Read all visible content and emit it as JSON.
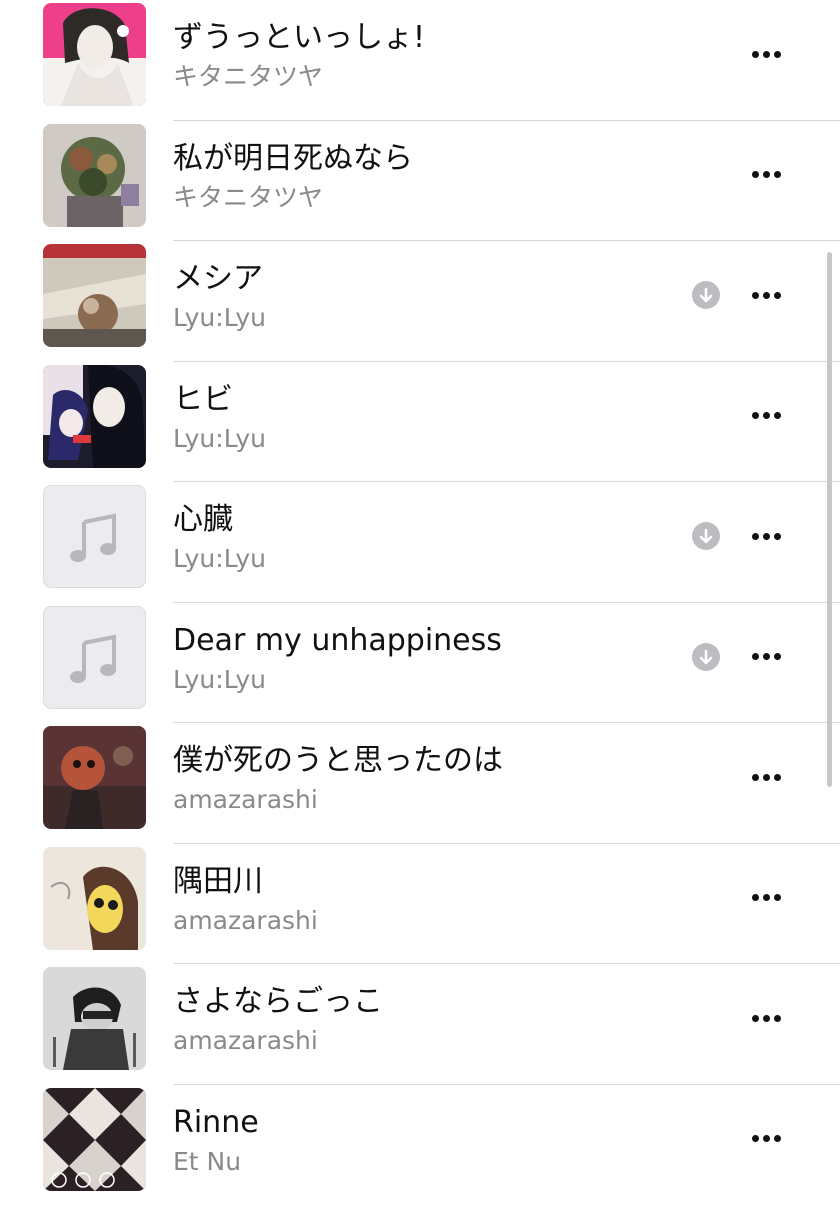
{
  "songs": [
    {
      "title": "ずうっといっしょ!",
      "artist": "キタニタツヤ",
      "downloaded": false,
      "artwork": "illustrated"
    },
    {
      "title": "私が明日死ぬなら",
      "artist": "キタニタツヤ",
      "downloaded": false,
      "artwork": "illustrated"
    },
    {
      "title": "メシア",
      "artist": "Lyu:Lyu",
      "downloaded": true,
      "artwork": "photo"
    },
    {
      "title": "ヒビ",
      "artist": "Lyu:Lyu",
      "downloaded": false,
      "artwork": "illustrated"
    },
    {
      "title": "心臓",
      "artist": "Lyu:Lyu",
      "downloaded": true,
      "artwork": "music-note-placeholder"
    },
    {
      "title": "Dear my unhappiness",
      "artist": "Lyu:Lyu",
      "downloaded": true,
      "artwork": "music-note-placeholder"
    },
    {
      "title": "僕が死のうと思ったのは",
      "artist": "amazarashi",
      "downloaded": false,
      "artwork": "illustrated"
    },
    {
      "title": "隅田川",
      "artist": "amazarashi",
      "downloaded": false,
      "artwork": "illustrated"
    },
    {
      "title": "さよならごっこ",
      "artist": "amazarashi",
      "downloaded": false,
      "artwork": "illustrated"
    },
    {
      "title": "Rinne",
      "artist": "Et Nu",
      "downloaded": false,
      "artwork": "argyle-pattern"
    }
  ],
  "icons": {
    "download": "downloaded-arrow-circle-icon",
    "more": "more-ellipsis-icon",
    "placeholder": "music-note-icon"
  },
  "colors": {
    "title": "#111111",
    "artist": "#8a8a8e",
    "separator": "#d8d8dc",
    "download_badge": "#bdbdc1",
    "placeholder_bg": "#ececee"
  }
}
